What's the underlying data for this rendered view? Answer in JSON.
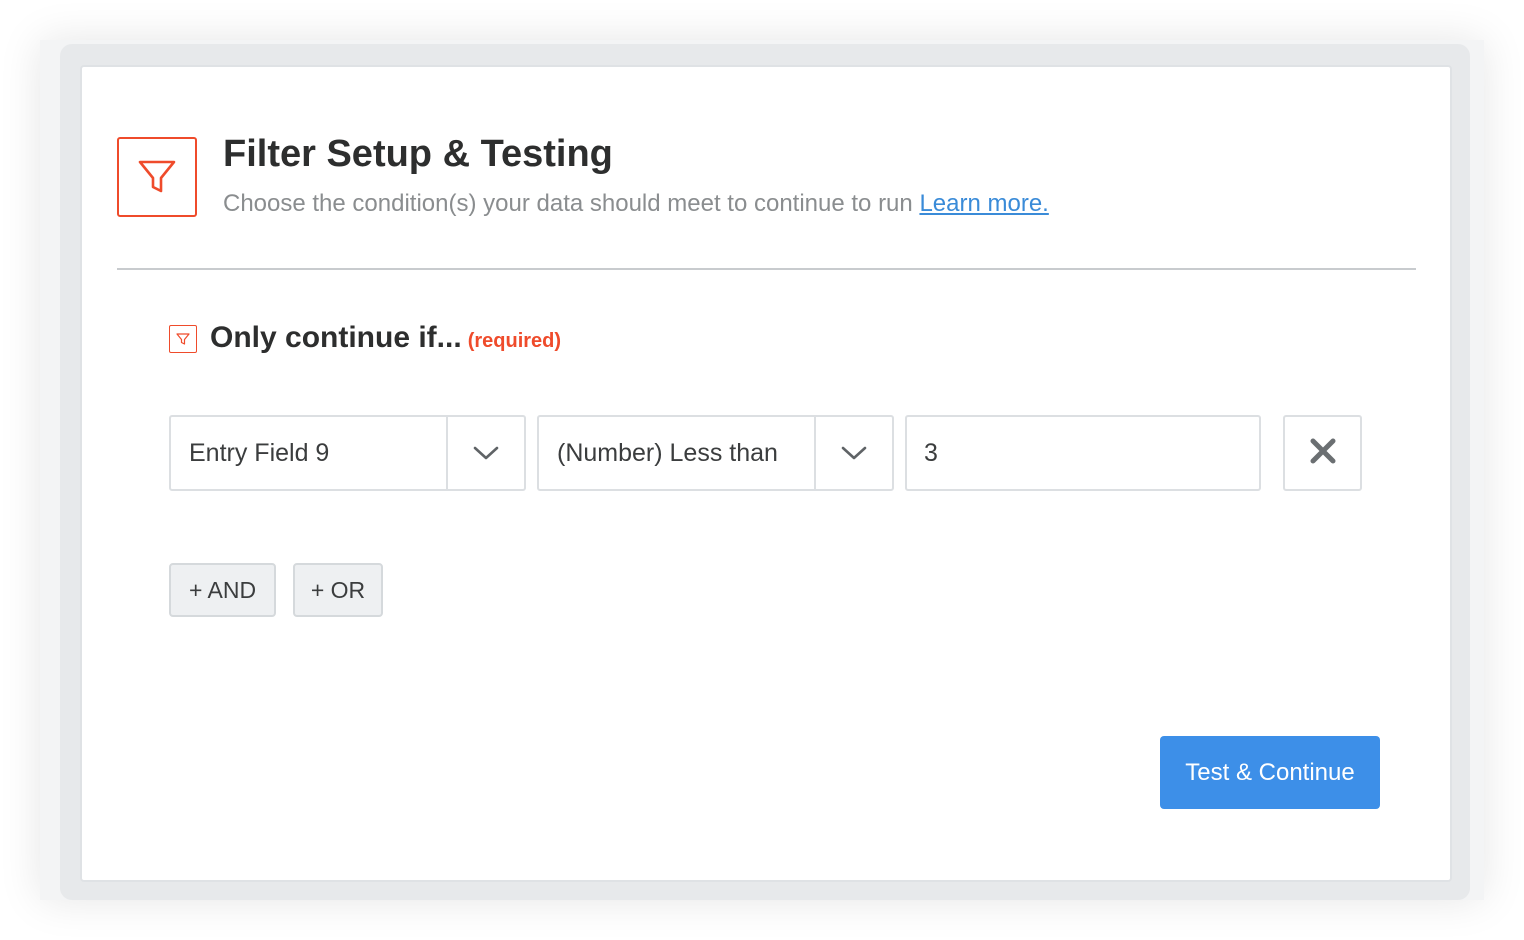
{
  "header": {
    "title": "Filter Setup & Testing",
    "subtitle": "Choose the condition(s) your data should meet to continue to run",
    "learn_more": "Learn more.",
    "icon": "filter-icon"
  },
  "section": {
    "title": "Only continue if...",
    "required_label": "(required)",
    "icon": "filter-icon"
  },
  "condition": {
    "field_value": "Entry Field 9",
    "operator_value": "(Number) Less than",
    "compare_value": "3"
  },
  "logic_buttons": {
    "and_label": "+ AND",
    "or_label": "+ OR"
  },
  "footer": {
    "submit_label": "Test & Continue"
  },
  "colors": {
    "accent": "#ef4b2b",
    "primary": "#3d8fe8",
    "link": "#3a8bd8"
  }
}
